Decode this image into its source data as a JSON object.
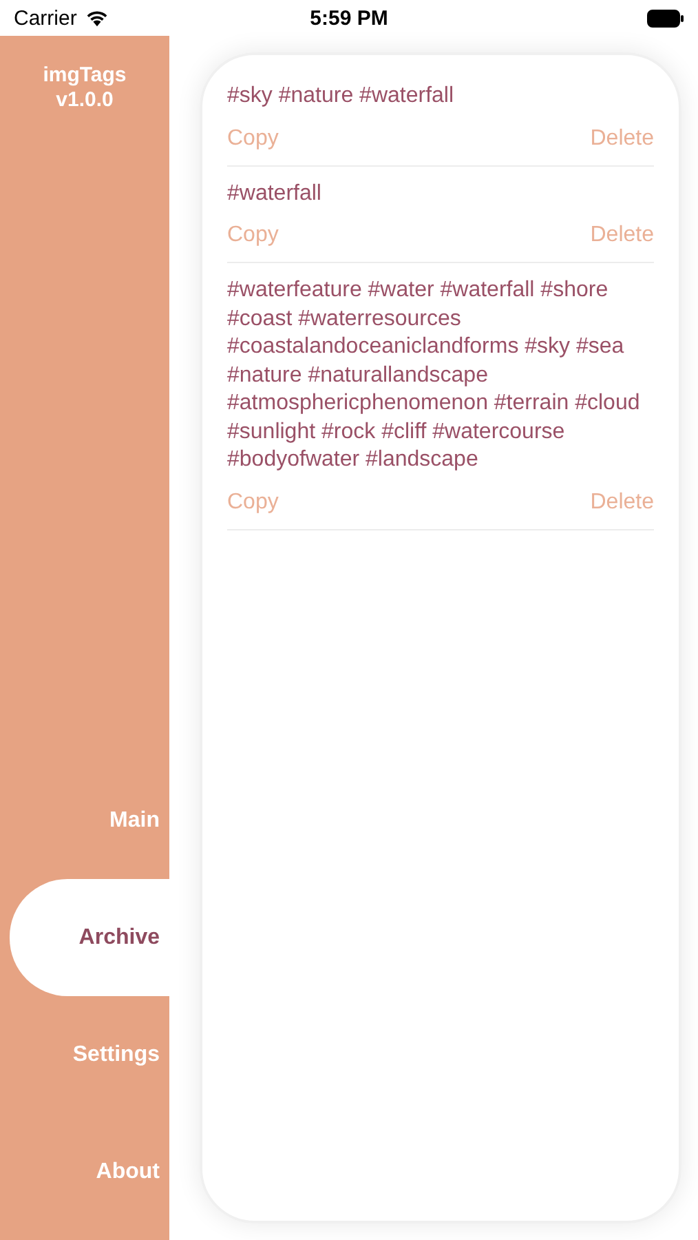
{
  "status_bar": {
    "carrier": "Carrier",
    "time": "5:59 PM"
  },
  "app": {
    "name": "imgTags",
    "version": "v1.0.0"
  },
  "nav": [
    {
      "label": "Main",
      "selected": false
    },
    {
      "label": "Archive",
      "selected": true
    },
    {
      "label": "Settings",
      "selected": false
    },
    {
      "label": "About",
      "selected": false
    }
  ],
  "entries": [
    {
      "tags": "#sky #nature #waterfall",
      "copy": "Copy",
      "delete": "Delete"
    },
    {
      "tags": "#waterfall",
      "copy": "Copy",
      "delete": "Delete"
    },
    {
      "tags": "#waterfeature #water #waterfall #shore #coast #waterresources #coastalandoceaniclandforms #sky #sea #nature #naturallandscape #atmosphericphenomenon #terrain #cloud #sunlight #rock #cliff #watercourse #bodyofwater #landscape",
      "copy": "Copy",
      "delete": "Delete"
    }
  ]
}
